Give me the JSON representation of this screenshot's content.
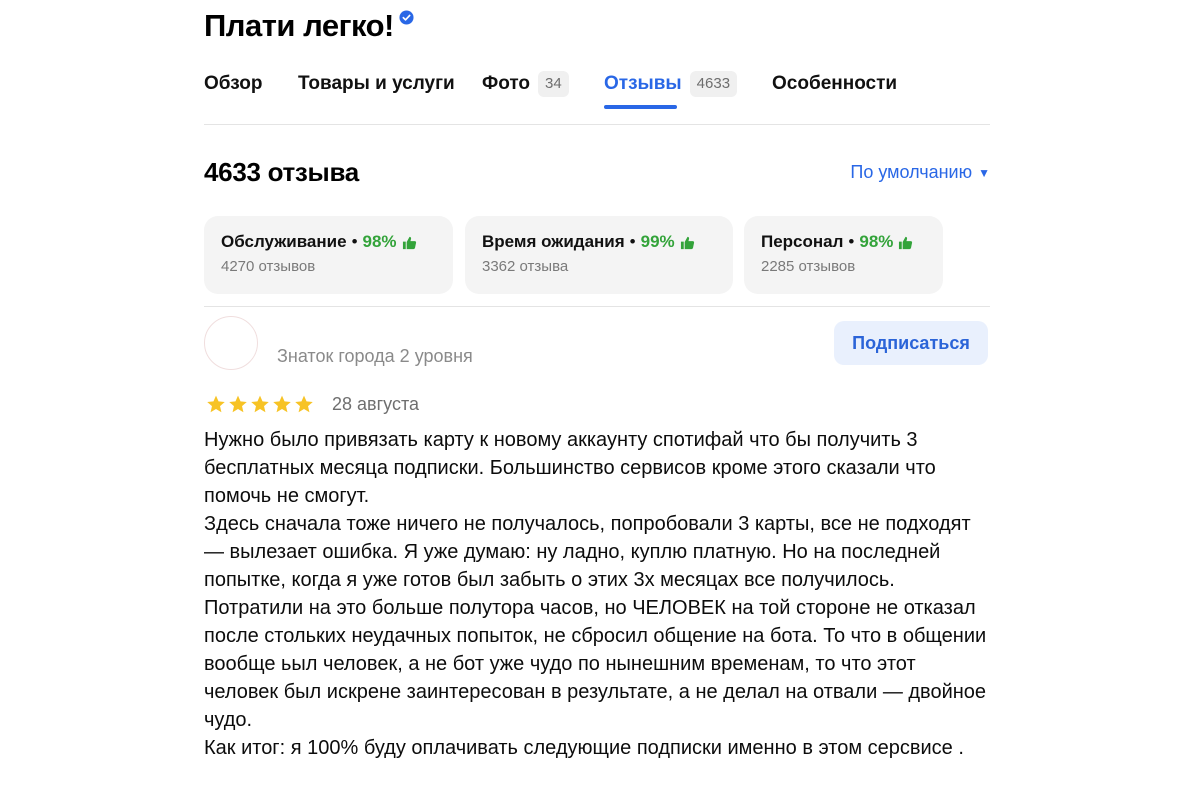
{
  "business": {
    "name": "Плати легко!",
    "verified_icon": "verified-badge-icon"
  },
  "tabs": [
    {
      "label": "Обзор",
      "count": null,
      "active": false
    },
    {
      "label": "Товары и услуги",
      "count": null,
      "active": false
    },
    {
      "label": "Фото",
      "count": "34",
      "active": false
    },
    {
      "label": "Отзывы",
      "count": "4633",
      "active": true
    },
    {
      "label": "Особенности",
      "count": null,
      "active": false
    }
  ],
  "reviews": {
    "header": "4633 отзыва",
    "sort_label": "По умолчанию",
    "sort_icon": "caret-down-icon"
  },
  "aspects": [
    {
      "name": "Обслуживание",
      "percent": "98%",
      "count_text": "4270 отзывов"
    },
    {
      "name": "Время ожидания",
      "percent": "99%",
      "count_text": "3362 отзыва"
    },
    {
      "name": "Персонал",
      "percent": "98%",
      "count_text": "2285 отзывов"
    }
  ],
  "colors": {
    "accent_blue": "#2967e6",
    "positive_green": "#33a33a",
    "star_yellow": "#f7c325"
  },
  "review": {
    "author_level": "Знаток города 2 уровня",
    "subscribe_label": "Подписаться",
    "rating": 5,
    "date": "28 августа",
    "paragraphs": [
      "Нужно было привязать карту к новому аккаунту спотифай что бы получить 3 бесплатных месяца подписки. Большинство сервисов кроме этого сказали что помочь не смогут.",
      "Здесь сначала тоже ничего не получалось, попробовали 3 карты, все не подходят — вылезает ошибка. Я уже думаю: ну ладно, куплю платную. Но на последней попытке, когда я уже готов был забыть о этих 3х месяцах все получилось. Потратили на это больше полутора часов, но ЧЕЛОВЕК на той стороне не отказал после стольких неудачных попыток, не сбросил общение на бота. То что в общении вообще ьыл человек, а не бот уже чудо по нынешним временам, то что этот человек был искрене заинтересован в результате, а не делал на отвали — двойное чудо.",
      "Как итог: я 100% буду оплачивать следующие подписки именно в этом серсвисе ."
    ]
  }
}
